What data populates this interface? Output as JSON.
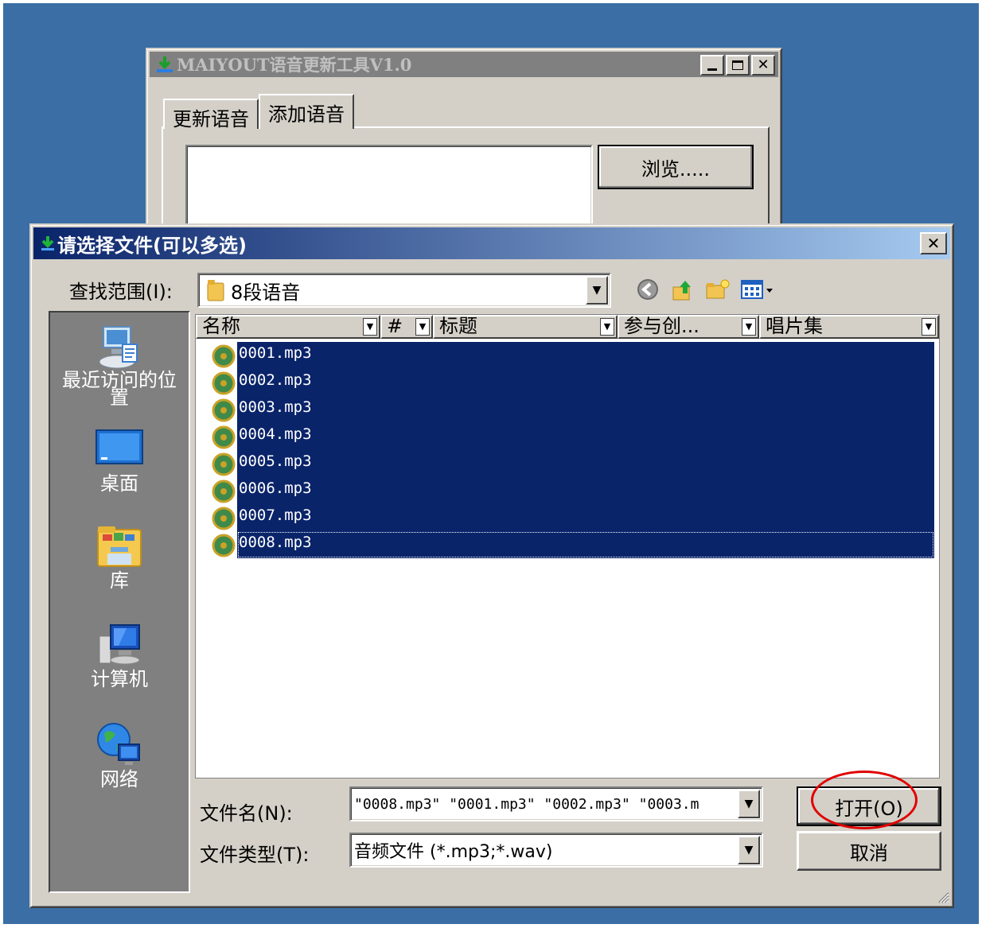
{
  "back_window": {
    "title": "MAIYOUT语音更新工具V1.0",
    "tabs": [
      {
        "label": "更新语音",
        "active": false
      },
      {
        "label": "添加语音",
        "active": true
      }
    ],
    "browse_label": "浏览....."
  },
  "dialog": {
    "title": "请选择文件(可以多选)",
    "close_glyph": "✕",
    "look_in_label": "查找范围(I):",
    "look_in_value": "8段语音",
    "places": [
      {
        "label": "最近访问的位置",
        "icon": "recent-places-icon"
      },
      {
        "label": "桌面",
        "icon": "desktop-icon"
      },
      {
        "label": "库",
        "icon": "library-icon"
      },
      {
        "label": "计算机",
        "icon": "computer-icon"
      },
      {
        "label": "网络",
        "icon": "network-icon"
      }
    ],
    "columns": [
      {
        "label": "名称"
      },
      {
        "label": "#"
      },
      {
        "label": "标题"
      },
      {
        "label": "参与创..."
      },
      {
        "label": "唱片集"
      }
    ],
    "files": [
      "0001.mp3",
      "0002.mp3",
      "0003.mp3",
      "0004.mp3",
      "0005.mp3",
      "0006.mp3",
      "0007.mp3",
      "0008.mp3"
    ],
    "filename_label": "文件名(N):",
    "filename_value": "\"0008.mp3\" \"0001.mp3\" \"0002.mp3\" \"0003.m",
    "filetype_label": "文件类型(T):",
    "filetype_value": "音频文件 (*.mp3;*.wav)",
    "open_label": "打开(O)",
    "cancel_label": "取消"
  },
  "colors": {
    "desktop": "#3a6ea5",
    "title_active": "#0a246a",
    "selection": "#0a246a",
    "highlight_circle": "#e00000"
  }
}
